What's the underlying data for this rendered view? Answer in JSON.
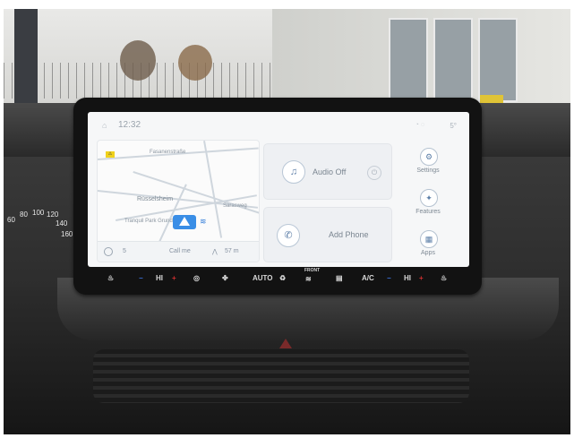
{
  "screen": {
    "status": {
      "time": "12:32",
      "temperature": "5°"
    },
    "map": {
      "labels": [
        "Fasanenstraße",
        "Tranquil Park Grund",
        "Rüsselsheim",
        "Sarasweg"
      ],
      "bar": {
        "left": "5",
        "middle": "Call me",
        "distance": "57 m"
      }
    },
    "tiles": {
      "audio": {
        "label": "Audio Off"
      },
      "phone": {
        "label": "Add Phone"
      }
    },
    "sidebar": [
      {
        "label": "Settings",
        "icon": "settings-icon"
      },
      {
        "label": "Features",
        "icon": "features-icon"
      },
      {
        "label": "Apps",
        "icon": "apps-icon"
      }
    ]
  },
  "climate": {
    "left_temp": "HI",
    "right_temp": "HI",
    "mode": "AUTO",
    "front_label": "FRONT",
    "ac_label": "A/C"
  },
  "cluster": {
    "speed_marks": [
      "60",
      "80",
      "100",
      "120",
      "140",
      "160"
    ]
  }
}
